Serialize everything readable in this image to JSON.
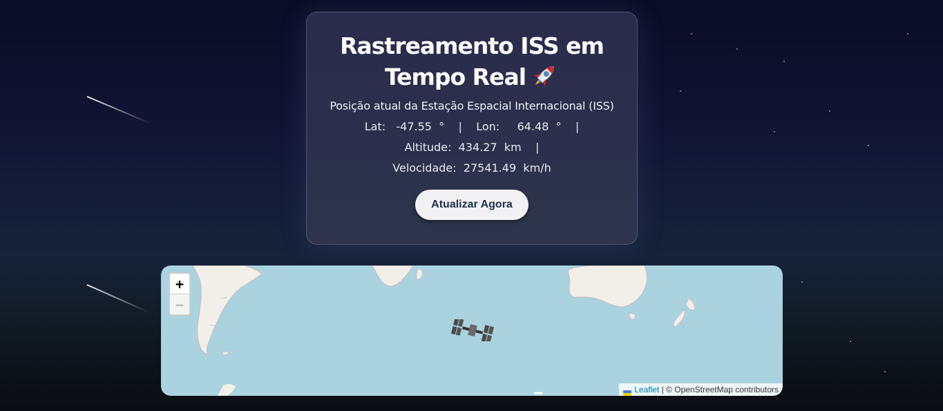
{
  "card": {
    "title_line1": "Rastreamento ISS em",
    "title_line2": "Tempo Real",
    "title_icon": "rocket-icon",
    "subtitle": "Posição atual da Estação Espacial Internacional (ISS)",
    "lat_label": "Lat:",
    "lat_value": "-47.55",
    "lat_unit": "°",
    "lon_label": "Lon:",
    "lon_value": "64.48",
    "lon_unit": "°",
    "separator": "|",
    "altitude_label": "Altitude:",
    "altitude_value": "434.27",
    "altitude_unit": "km",
    "velocity_label": "Velocidade:",
    "velocity_value": "27541.49",
    "velocity_unit": "km/h",
    "refresh_button": "Atualizar Agora"
  },
  "map": {
    "zoom_in": "+",
    "zoom_out": "−",
    "marker_icon": "iss-station-icon",
    "attribution": {
      "leaflet": "Leaflet",
      "rest": "| © OpenStreetMap contributors",
      "flag_icon": "ukraine-flag-icon"
    },
    "colors": {
      "ocean": "#aad3df",
      "land": "#f2efe9"
    }
  },
  "background": {
    "colors": [
      "#0b0c26",
      "#16233a",
      "#0a0c12"
    ]
  }
}
